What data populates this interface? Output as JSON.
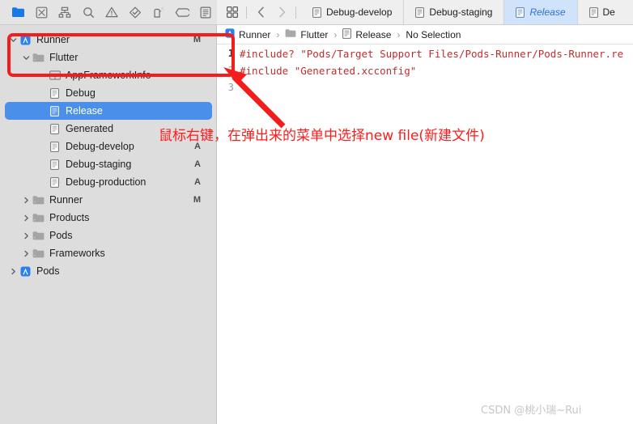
{
  "nav_toolbar": {
    "buttons": [
      {
        "name": "folder-icon",
        "label": "Project navigator",
        "active": true
      },
      {
        "name": "source-control-icon",
        "label": "Source control navigator",
        "active": false
      },
      {
        "name": "hierarchy-icon",
        "label": "Symbol navigator",
        "active": false
      },
      {
        "name": "search-icon",
        "label": "Find navigator",
        "active": false
      },
      {
        "name": "warning-triangle-icon",
        "label": "Issue navigator",
        "active": false
      },
      {
        "name": "test-diamond-icon",
        "label": "Test navigator",
        "active": false
      },
      {
        "name": "debug-gauge-icon",
        "label": "Debug navigator",
        "active": false
      },
      {
        "name": "breakpoint-tag-icon",
        "label": "Breakpoint navigator",
        "active": false
      },
      {
        "name": "report-list-icon",
        "label": "Report navigator",
        "active": false
      }
    ]
  },
  "sidebar": {
    "items": [
      {
        "label": "Runner",
        "icon": "xcode-project-icon",
        "twisty": "down",
        "indent": 0,
        "status": "M",
        "selected": false
      },
      {
        "label": "Flutter",
        "icon": "folder-icon",
        "twisty": "down",
        "indent": 1,
        "status": "",
        "selected": false
      },
      {
        "label": "AppFrameworkInfo",
        "icon": "plist-icon",
        "twisty": "none",
        "indent": 2,
        "status": "",
        "selected": false
      },
      {
        "label": "Debug",
        "icon": "xcconfig-icon",
        "twisty": "none",
        "indent": 2,
        "status": "",
        "selected": false
      },
      {
        "label": "Release",
        "icon": "xcconfig-icon",
        "twisty": "none",
        "indent": 2,
        "status": "",
        "selected": true
      },
      {
        "label": "Generated",
        "icon": "xcconfig-icon",
        "twisty": "none",
        "indent": 2,
        "status": "",
        "selected": false
      },
      {
        "label": "Debug-develop",
        "icon": "xcconfig-icon",
        "twisty": "none",
        "indent": 2,
        "status": "A",
        "selected": false
      },
      {
        "label": "Debug-staging",
        "icon": "xcconfig-icon",
        "twisty": "none",
        "indent": 2,
        "status": "A",
        "selected": false
      },
      {
        "label": "Debug-production",
        "icon": "xcconfig-icon",
        "twisty": "none",
        "indent": 2,
        "status": "A",
        "selected": false
      },
      {
        "label": "Runner",
        "icon": "folder-icon",
        "twisty": "right",
        "indent": 1,
        "status": "M",
        "selected": false
      },
      {
        "label": "Products",
        "icon": "folder-icon",
        "twisty": "right",
        "indent": 1,
        "status": "",
        "selected": false
      },
      {
        "label": "Pods",
        "icon": "folder-icon",
        "twisty": "right",
        "indent": 1,
        "status": "",
        "selected": false
      },
      {
        "label": "Frameworks",
        "icon": "folder-icon",
        "twisty": "right",
        "indent": 1,
        "status": "",
        "selected": false
      },
      {
        "label": "Pods",
        "icon": "xcode-project-icon",
        "twisty": "right",
        "indent": 0,
        "status": "",
        "selected": false
      }
    ]
  },
  "tabbar": {
    "grid_button": "tab-grid-icon",
    "back_button": "chevron-left-icon",
    "forward_button": "chevron-right-icon",
    "tabs": [
      {
        "label": "Debug-develop",
        "icon": "xcconfig-icon",
        "active": false
      },
      {
        "label": "Debug-staging",
        "icon": "xcconfig-icon",
        "active": false
      },
      {
        "label": "Release",
        "icon": "xcconfig-icon",
        "active": true
      },
      {
        "label": "De",
        "icon": "xcconfig-icon",
        "active": false
      }
    ]
  },
  "breadcrumb": {
    "items": [
      {
        "label": "Runner",
        "icon": "xcode-project-icon"
      },
      {
        "label": "Flutter",
        "icon": "folder-icon"
      },
      {
        "label": "Release",
        "icon": "xcconfig-icon"
      },
      {
        "label": "No Selection",
        "icon": "none"
      }
    ],
    "separator": "›"
  },
  "editor": {
    "lines": [
      {
        "number": "1",
        "text": "#include? \"Pods/Target Support Files/Pods-Runner/Pods-Runner.re",
        "current": true
      },
      {
        "number": "2",
        "text": "#include \"Generated.xcconfig\"",
        "current": false
      },
      {
        "number": "3",
        "text": "",
        "current": false
      }
    ]
  },
  "annotation": {
    "note": "鼠标右键，在弹出来的菜单中选择new file(新建文件)",
    "highlight_color": "#f41d1d",
    "arrow_name": "red-arrow-annotation",
    "rect_name": "red-highlight-rectangle"
  },
  "watermark": {
    "text": "CSDN @桃小瑞~Rui"
  },
  "colors": {
    "selection_blue": "#4a90ea",
    "active_tab_blue": "#cfe3fb",
    "tab_text_blue": "#2f6ee0",
    "annotation_red": "#fc1c1c",
    "code_red": "#c02e2e",
    "sidebar_gray": "#dddddd"
  }
}
